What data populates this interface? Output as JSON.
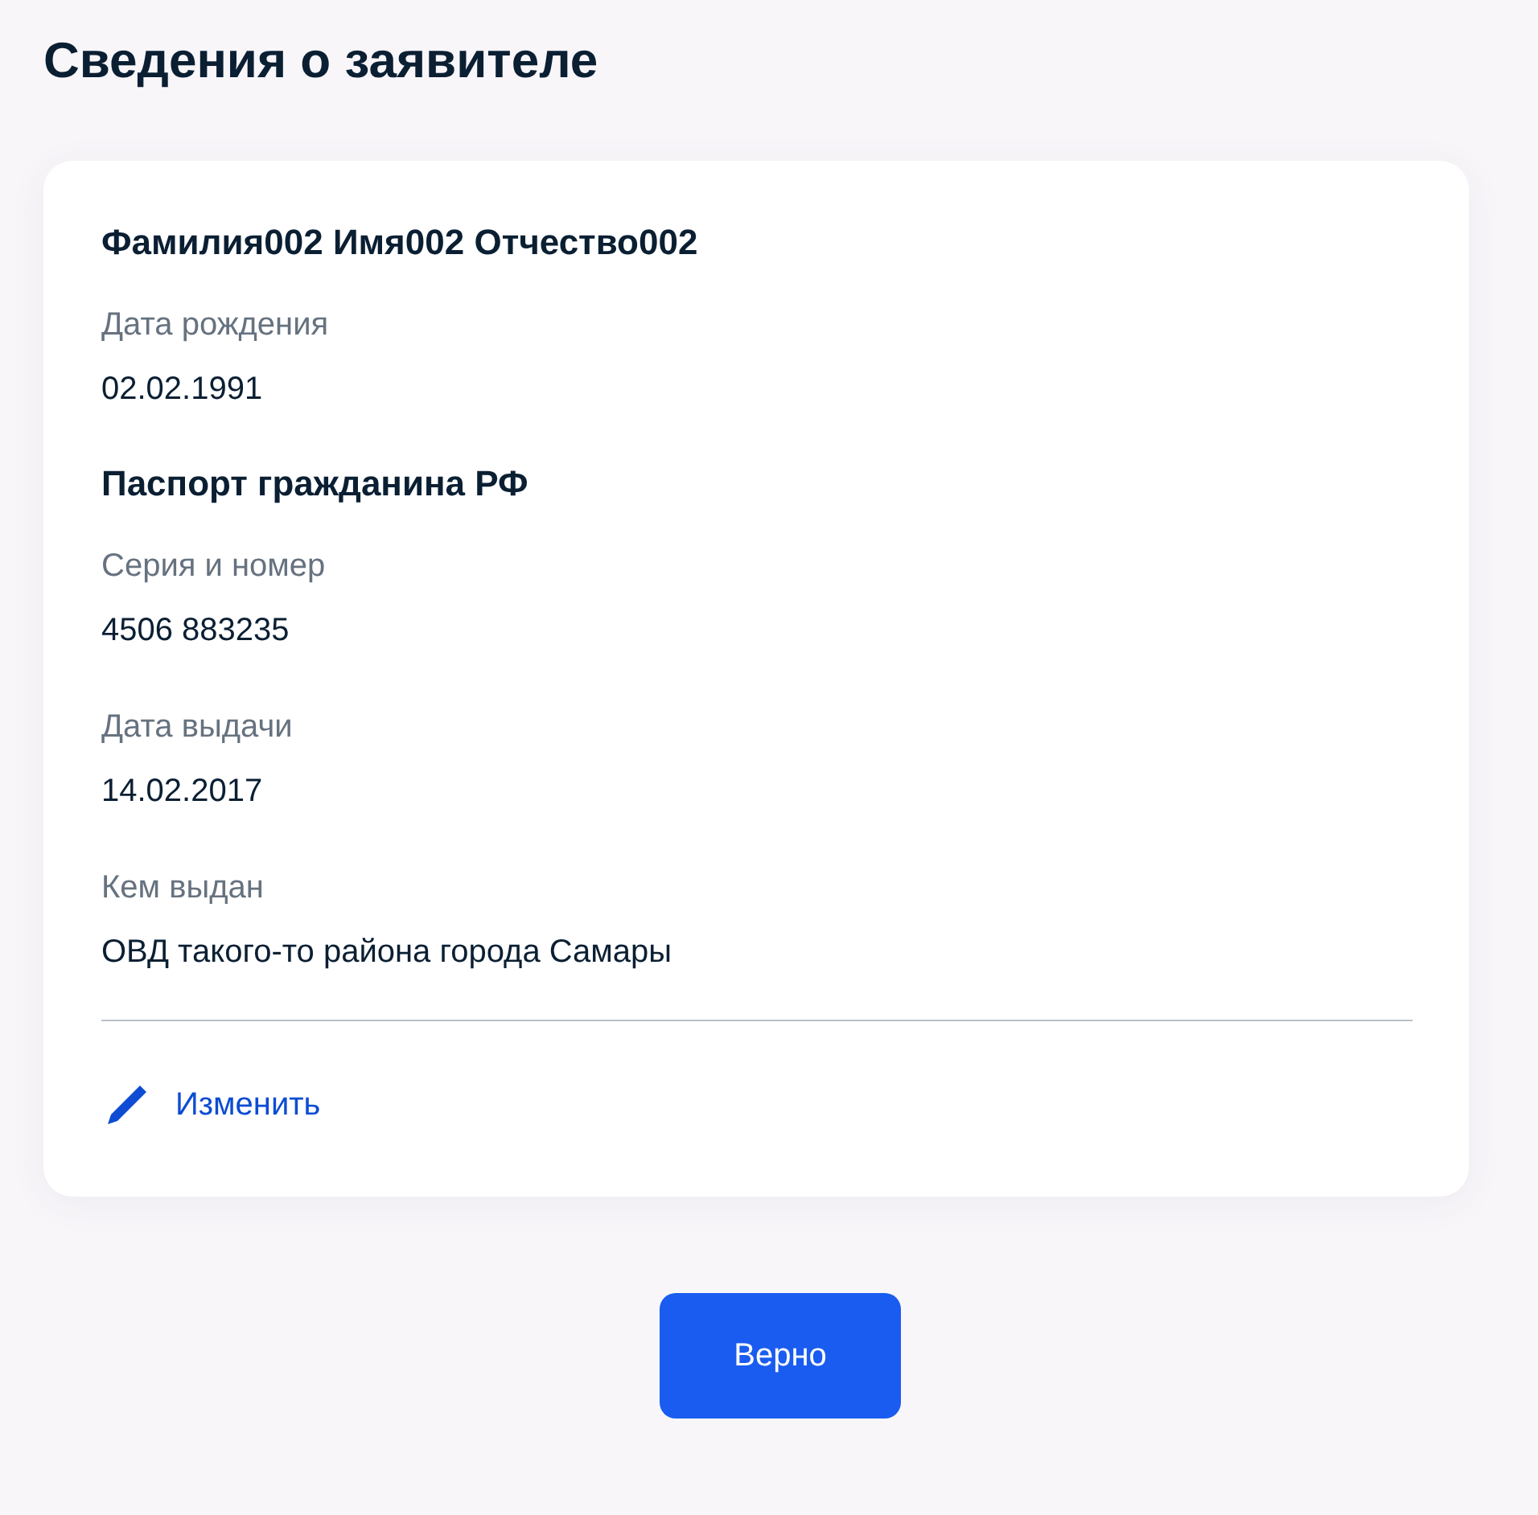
{
  "title": "Сведения о заявителе",
  "card": {
    "name": "Фамилия002 Имя002 Отчество002",
    "personal_fields": [
      {
        "label": "Дата рождения",
        "value": "02.02.1991"
      }
    ],
    "document_title": "Паспорт гражданина РФ",
    "document_fields": [
      {
        "label": "Серия и номер",
        "value": "4506 883235"
      },
      {
        "label": "Дата выдачи",
        "value": "14.02.2017"
      },
      {
        "label": "Кем выдан",
        "value": "ОВД такого-то района города Самары"
      }
    ],
    "edit_link": "Изменить"
  },
  "confirm_button": "Верно"
}
